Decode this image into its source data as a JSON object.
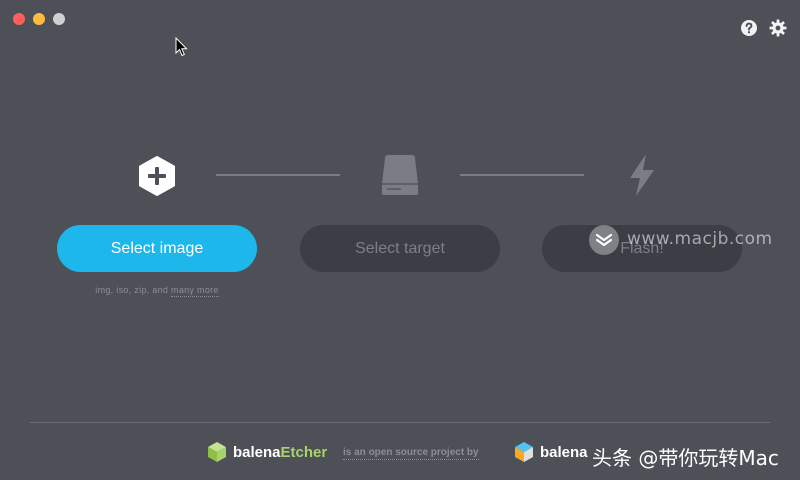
{
  "window": {
    "controls": [
      "close",
      "minimize",
      "maximize"
    ],
    "icons": {
      "help": "help-icon",
      "settings": "gear-icon"
    }
  },
  "steps": {
    "image": {
      "icon": "plus-hexagon-icon",
      "button_label": "Select image",
      "formats_prefix": "img, iso, zip, and",
      "formats_link": "many more"
    },
    "target": {
      "icon": "drive-icon",
      "button_label": "Select target"
    },
    "flash": {
      "icon": "lightning-icon",
      "button_label": "Flash!"
    }
  },
  "footer": {
    "brand_prefix": "balena",
    "brand_suffix": "Etcher",
    "tagline": "is an open source project by",
    "company": "balena"
  },
  "watermark": {
    "site": "www.macjb.com",
    "cn_text": "头条 @带你玩转Mac"
  },
  "colors": {
    "background": "#4d5057",
    "primary": "#1eb7ec",
    "disabled_button": "#3b3e45",
    "brand_accent": "#a8d26b"
  }
}
